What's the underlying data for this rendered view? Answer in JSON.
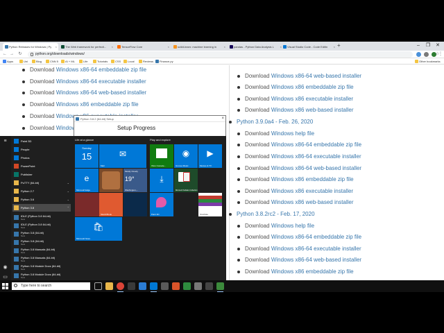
{
  "browser": {
    "tabs": [
      {
        "label": "Python Releases for Windows | Py",
        "color": "#3776ab",
        "active": true
      },
      {
        "label": "The Web framework for perfecti...",
        "color": "#0c4b33",
        "active": false
      },
      {
        "label": "TensorFlow Core",
        "color": "#ff6f00",
        "active": false
      },
      {
        "label": "scikit-learn: machine learning in",
        "color": "#f7931e",
        "active": false
      },
      {
        "label": "pandas - Python Data Analysis L",
        "color": "#150458",
        "active": false
      },
      {
        "label": "Visual Studio Code - Code Editin",
        "color": "#0078d4",
        "active": false
      }
    ],
    "new_tab": "+",
    "url": "python.org/downloads/windows/",
    "bookmarks": [
      "Apps",
      "Uni",
      "Blog",
      "CNN 5",
      "AI + ML",
      "Life",
      "Tutorials",
      "CSS",
      "Local",
      "Reviews",
      "Finance.py"
    ],
    "other_bookmarks": "Other bookmarks"
  },
  "page": {
    "left_items": [
      {
        "prefix": "Download",
        "link": "Windows x86-64 embeddable zip file"
      },
      {
        "prefix": "Download",
        "link": "Windows x86-64 executable installer"
      },
      {
        "prefix": "Download",
        "link": "Windows x86-64 web-based installer"
      },
      {
        "prefix": "Download",
        "link": "Windows x86 embeddable zip file"
      },
      {
        "prefix": "Download",
        "link": "Windows x86 executable installer"
      },
      {
        "prefix": "Download",
        "link": "Windows x86 web-based installer"
      }
    ],
    "right_top": [
      {
        "prefix": "Download",
        "link": "Windows x86-64 web-based installer"
      },
      {
        "prefix": "Download",
        "link": "Windows x86 embeddable zip file"
      },
      {
        "prefix": "Download",
        "link": "Windows x86 executable installer"
      },
      {
        "prefix": "Download",
        "link": "Windows x86 web-based installer"
      }
    ],
    "release1": "Python 3.9.0a4 - Feb. 26, 2020",
    "release1_items": [
      {
        "prefix": "Download",
        "link": "Windows help file"
      },
      {
        "prefix": "Download",
        "link": "Windows x86-64 embeddable zip file"
      },
      {
        "prefix": "Download",
        "link": "Windows x86-64 executable installer"
      },
      {
        "prefix": "Download",
        "link": "Windows x86-64 web-based installer"
      },
      {
        "prefix": "Download",
        "link": "Windows x86 embeddable zip file"
      },
      {
        "prefix": "Download",
        "link": "Windows x86 executable installer"
      },
      {
        "prefix": "Download",
        "link": "Windows x86 web-based installer"
      }
    ],
    "release2": "Python 3.8.2rc2 - Feb. 17, 2020",
    "release2_items": [
      {
        "prefix": "Download",
        "link": "Windows help file"
      },
      {
        "prefix": "Download",
        "link": "Windows x86-64 embeddable zip file"
      },
      {
        "prefix": "Download",
        "link": "Windows x86-64 executable installer"
      },
      {
        "prefix": "Download",
        "link": "Windows x86-64 web-based installer"
      },
      {
        "prefix": "Download",
        "link": "Windows x86 embeddable zip file"
      }
    ]
  },
  "setup": {
    "title": "Python 3.8.2 (64-bit) Setup",
    "heading": "Setup Progress",
    "close": "×"
  },
  "start_menu": {
    "apps": [
      {
        "label": "Paint 3D",
        "color": "#0078d7",
        "sub": "",
        "chevron": ""
      },
      {
        "label": "People",
        "color": "#0078d7",
        "sub": "",
        "chevron": ""
      },
      {
        "label": "Photos",
        "color": "#0078d7",
        "sub": "",
        "chevron": ""
      },
      {
        "label": "PowerPoint",
        "color": "#d24726",
        "sub": "",
        "chevron": ""
      },
      {
        "label": "Publisher",
        "color": "#077568",
        "sub": "",
        "chevron": ""
      },
      {
        "label": "PuTTY (64-bit)",
        "color": "#e8b64a",
        "sub": "",
        "chevron": "⌄"
      },
      {
        "label": "Python 2.7",
        "color": "#e8b64a",
        "sub": "",
        "chevron": "⌄"
      },
      {
        "label": "Python 3.6",
        "color": "#e8b64a",
        "sub": "",
        "chevron": "⌄"
      },
      {
        "label": "Python 3.8",
        "color": "#e8b64a",
        "sub": "",
        "chevron": "⌃",
        "highlight": true
      },
      {
        "label": "IDLE (Python 3.8 64-bit)",
        "color": "#3776ab",
        "sub": "New",
        "chevron": ""
      },
      {
        "label": "IDLE (Python 3.8 64-bit)",
        "color": "#3776ab",
        "sub": "New",
        "chevron": ""
      },
      {
        "label": "Python 3.8 (64-bit)",
        "color": "#3776ab",
        "sub": "New",
        "chevron": ""
      },
      {
        "label": "Python 3.8 (64-bit)",
        "color": "#3776ab",
        "sub": "New",
        "chevron": ""
      },
      {
        "label": "Python 3.8 Manuals (64-bit)",
        "color": "#3776ab",
        "sub": "New",
        "chevron": ""
      },
      {
        "label": "Python 3.8 Manuals (64-bit)",
        "color": "#3776ab",
        "sub": "New",
        "chevron": ""
      },
      {
        "label": "Python 3.8 Module Docs (64-bit)",
        "color": "#3776ab",
        "sub": "New",
        "chevron": ""
      },
      {
        "label": "Python 3.8 Module Docs (64-bit)",
        "color": "#3776ab",
        "sub": "New",
        "chevron": ""
      }
    ],
    "group1": "Life at a glance",
    "group2": "Play and explore",
    "tiles": {
      "calendar_day": "Sunday",
      "calendar_date": "15",
      "mail": "Mail",
      "edge": "Microsoft Edge",
      "weather_title": "Mostly Cloudy",
      "weather_temp": "19°",
      "weather_city": "Washington,...",
      "xbox": "Xbox Console...",
      "groove": "Groove Music",
      "movies": "Movies & TV",
      "solitaire": "Microsoft Solitaire Collection",
      "paint3d": "Paint 3D",
      "sketchbook": "SketchBook",
      "onenote": "OneNote",
      "store": "Microsoft Store"
    }
  },
  "taskbar": {
    "search_placeholder": "Type here to search"
  }
}
